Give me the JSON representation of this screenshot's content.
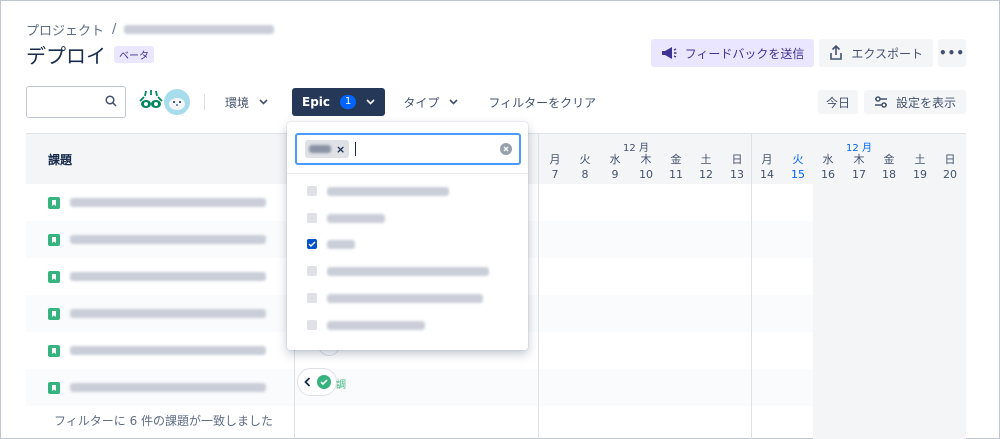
{
  "breadcrumb": {
    "root": "プロジェクト",
    "separator": "/"
  },
  "page": {
    "title": "デプロイ",
    "badge": "ベータ"
  },
  "actions": {
    "feedback": "フィードバックを送信",
    "export": "エクスポート",
    "more": "•••"
  },
  "filters": {
    "search_placeholder": "",
    "environment": "環境",
    "epic": "Epic",
    "epic_count": "1",
    "type": "タイプ",
    "clear": "フィルターをクリア",
    "today": "今日",
    "settings": "設定を表示"
  },
  "issues": {
    "header": "課題",
    "found": "フィルターに 6 件の課題が一致しました",
    "count": 6
  },
  "timeline": {
    "months": [
      {
        "label": "12 月",
        "current": false
      },
      {
        "label": "12 月",
        "current": true
      }
    ],
    "week1": [
      {
        "wd": "月",
        "d": "7"
      },
      {
        "wd": "火",
        "d": "8"
      },
      {
        "wd": "水",
        "d": "9"
      },
      {
        "wd": "木",
        "d": "10"
      },
      {
        "wd": "金",
        "d": "11"
      },
      {
        "wd": "土",
        "d": "12"
      },
      {
        "wd": "日",
        "d": "13"
      }
    ],
    "week2": [
      {
        "wd": "月",
        "d": "14"
      },
      {
        "wd": "火",
        "d": "15",
        "today": true
      },
      {
        "wd": "水",
        "d": "16"
      },
      {
        "wd": "木",
        "d": "17"
      },
      {
        "wd": "金",
        "d": "18"
      },
      {
        "wd": "土",
        "d": "19"
      },
      {
        "wd": "日",
        "d": "20"
      }
    ]
  },
  "epic_dropdown": {
    "chip_close": "×",
    "options_count": 6,
    "checked_index": 2
  },
  "pill": {
    "label": "調"
  },
  "colors": {
    "accent": "#0052cc",
    "story": "#36b37e",
    "feedback_bg": "#eae6ff",
    "epic_btn": "#253858"
  }
}
